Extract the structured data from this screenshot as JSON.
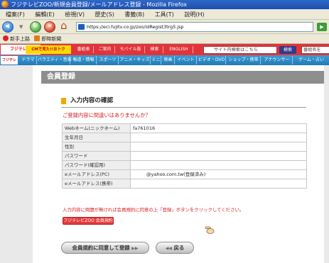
{
  "window": {
    "title": "フジテレビZOO/新規会員登録/メールアドレス登録 - Mozilla Firefox"
  },
  "menu": [
    "檔案(F)",
    "編輯(E)",
    "檢視(V)",
    "歷史(S)",
    "書籤(B)",
    "工具(T)",
    "說明(H)"
  ],
  "address": {
    "url": "https://ecl.fujitv.co.jp/zoo/idRegist3trg5.jsp"
  },
  "bookmarks": [
    "新手上路",
    "即時新聞"
  ],
  "site": {
    "logo": "フジテレビ",
    "sponsor": "CMで見た!!おトク",
    "top_nav": [
      "番組表",
      "ご案内",
      "モバイル版",
      "検索",
      "ENGLISH"
    ],
    "search_placeholder": "サイト内検索はこちら",
    "search_button": "検索",
    "program_search": "番組名を",
    "logo2": "フジテレビ",
    "genres": [
      "ドラマ",
      "バラエティ・音楽",
      "報道・情報",
      "スポーツ",
      "アニメ・キッズ",
      "ミニ",
      "映画",
      "イベント",
      "ビデオ・DVD",
      "ショップ・携帯",
      "アナウンサー",
      "ゲーム・占い"
    ]
  },
  "page": {
    "banner_title": "会員登録",
    "section_title": "入力内容の確認",
    "question": "ご登録内容に間違いはありませんか？",
    "fields": [
      {
        "label": "Webネーム(ニックネーム)",
        "value": "fa761016"
      },
      {
        "label": "生年月日",
        "value": ""
      },
      {
        "label": "性別",
        "value": ""
      },
      {
        "label": "パスワード",
        "value": ""
      },
      {
        "label": "パスワード(確認用)",
        "value": ""
      },
      {
        "label": "eメールアドレス(PC)",
        "value": "@yahoo.com.tw(登録済み)"
      },
      {
        "label": "eメールアドレス(携帯)",
        "value": ""
      }
    ],
    "notice": "入力内容に問題が無ければ会員規約に同意の上「登録」ボタンをクリックしてください。",
    "terms_button": "フジテレビZOO 会員規約",
    "agree_button": "会員規約に同意して登録",
    "back_button": "戻る"
  }
}
